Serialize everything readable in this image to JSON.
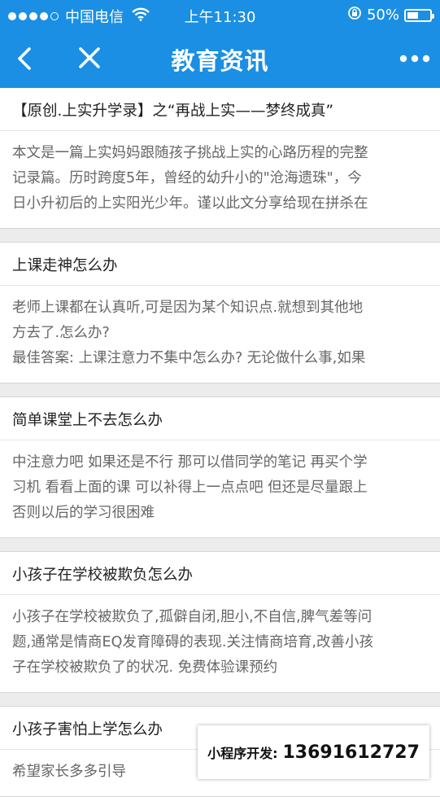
{
  "status_bar": {
    "carrier": "中国电信",
    "time": "上午11:30",
    "battery": "50%",
    "battery_level": 0.5,
    "signal_bars": 4,
    "signal_total": 5
  },
  "nav": {
    "title": "教育资讯",
    "back_icon": "chevron-left-icon",
    "close_icon": "close-icon",
    "more_icon": "more-dots-icon"
  },
  "articles": [
    {
      "title": "【原创.上实升学录】之“再战上实——梦终成真”",
      "body": "本文是一篇上实妈妈跟随孩子挑战上实的心路历程的完整\n记录篇。历时跨度5年，曾经的幼升小的\"沧海遗珠\"，今\n日小升初后的上实阳光少年。谨以此文分享给现在拼杀在"
    },
    {
      "title": "上课走神怎么办",
      "body": "老师上课都在认真听,可是因为某个知识点.就想到其他地\n方去了.怎么办?\n最佳答案: 上课注意力不集中怎么办? 无论做什么事,如果"
    },
    {
      "title": "简单课堂上不去怎么办",
      "body": "中注意力吧 如果还是不行 那可以借同学的笔记 再买个学\n习机 看看上面的课 可以补得上一点点吧 但还是尽量跟上\n否则以后的学习很困难"
    },
    {
      "title": "小孩子在学校被欺负怎么办",
      "body": "小孩子在学校被欺负了,孤僻自闭,胆小,不自信,脾气差等问\n题,通常是情商EQ发育障碍的表现.关注情商培育,改善小孩\n子在学校被欺负了的状况. 免费体验课预约"
    },
    {
      "title": "小孩子害怕上学怎么办",
      "body": "希望家长多多引导"
    }
  ],
  "watermark": {
    "label": "小程序开发:",
    "number": "13691612727"
  },
  "colors": {
    "nav_bg": "#1a8fe3",
    "page_bg": "#ececec"
  }
}
